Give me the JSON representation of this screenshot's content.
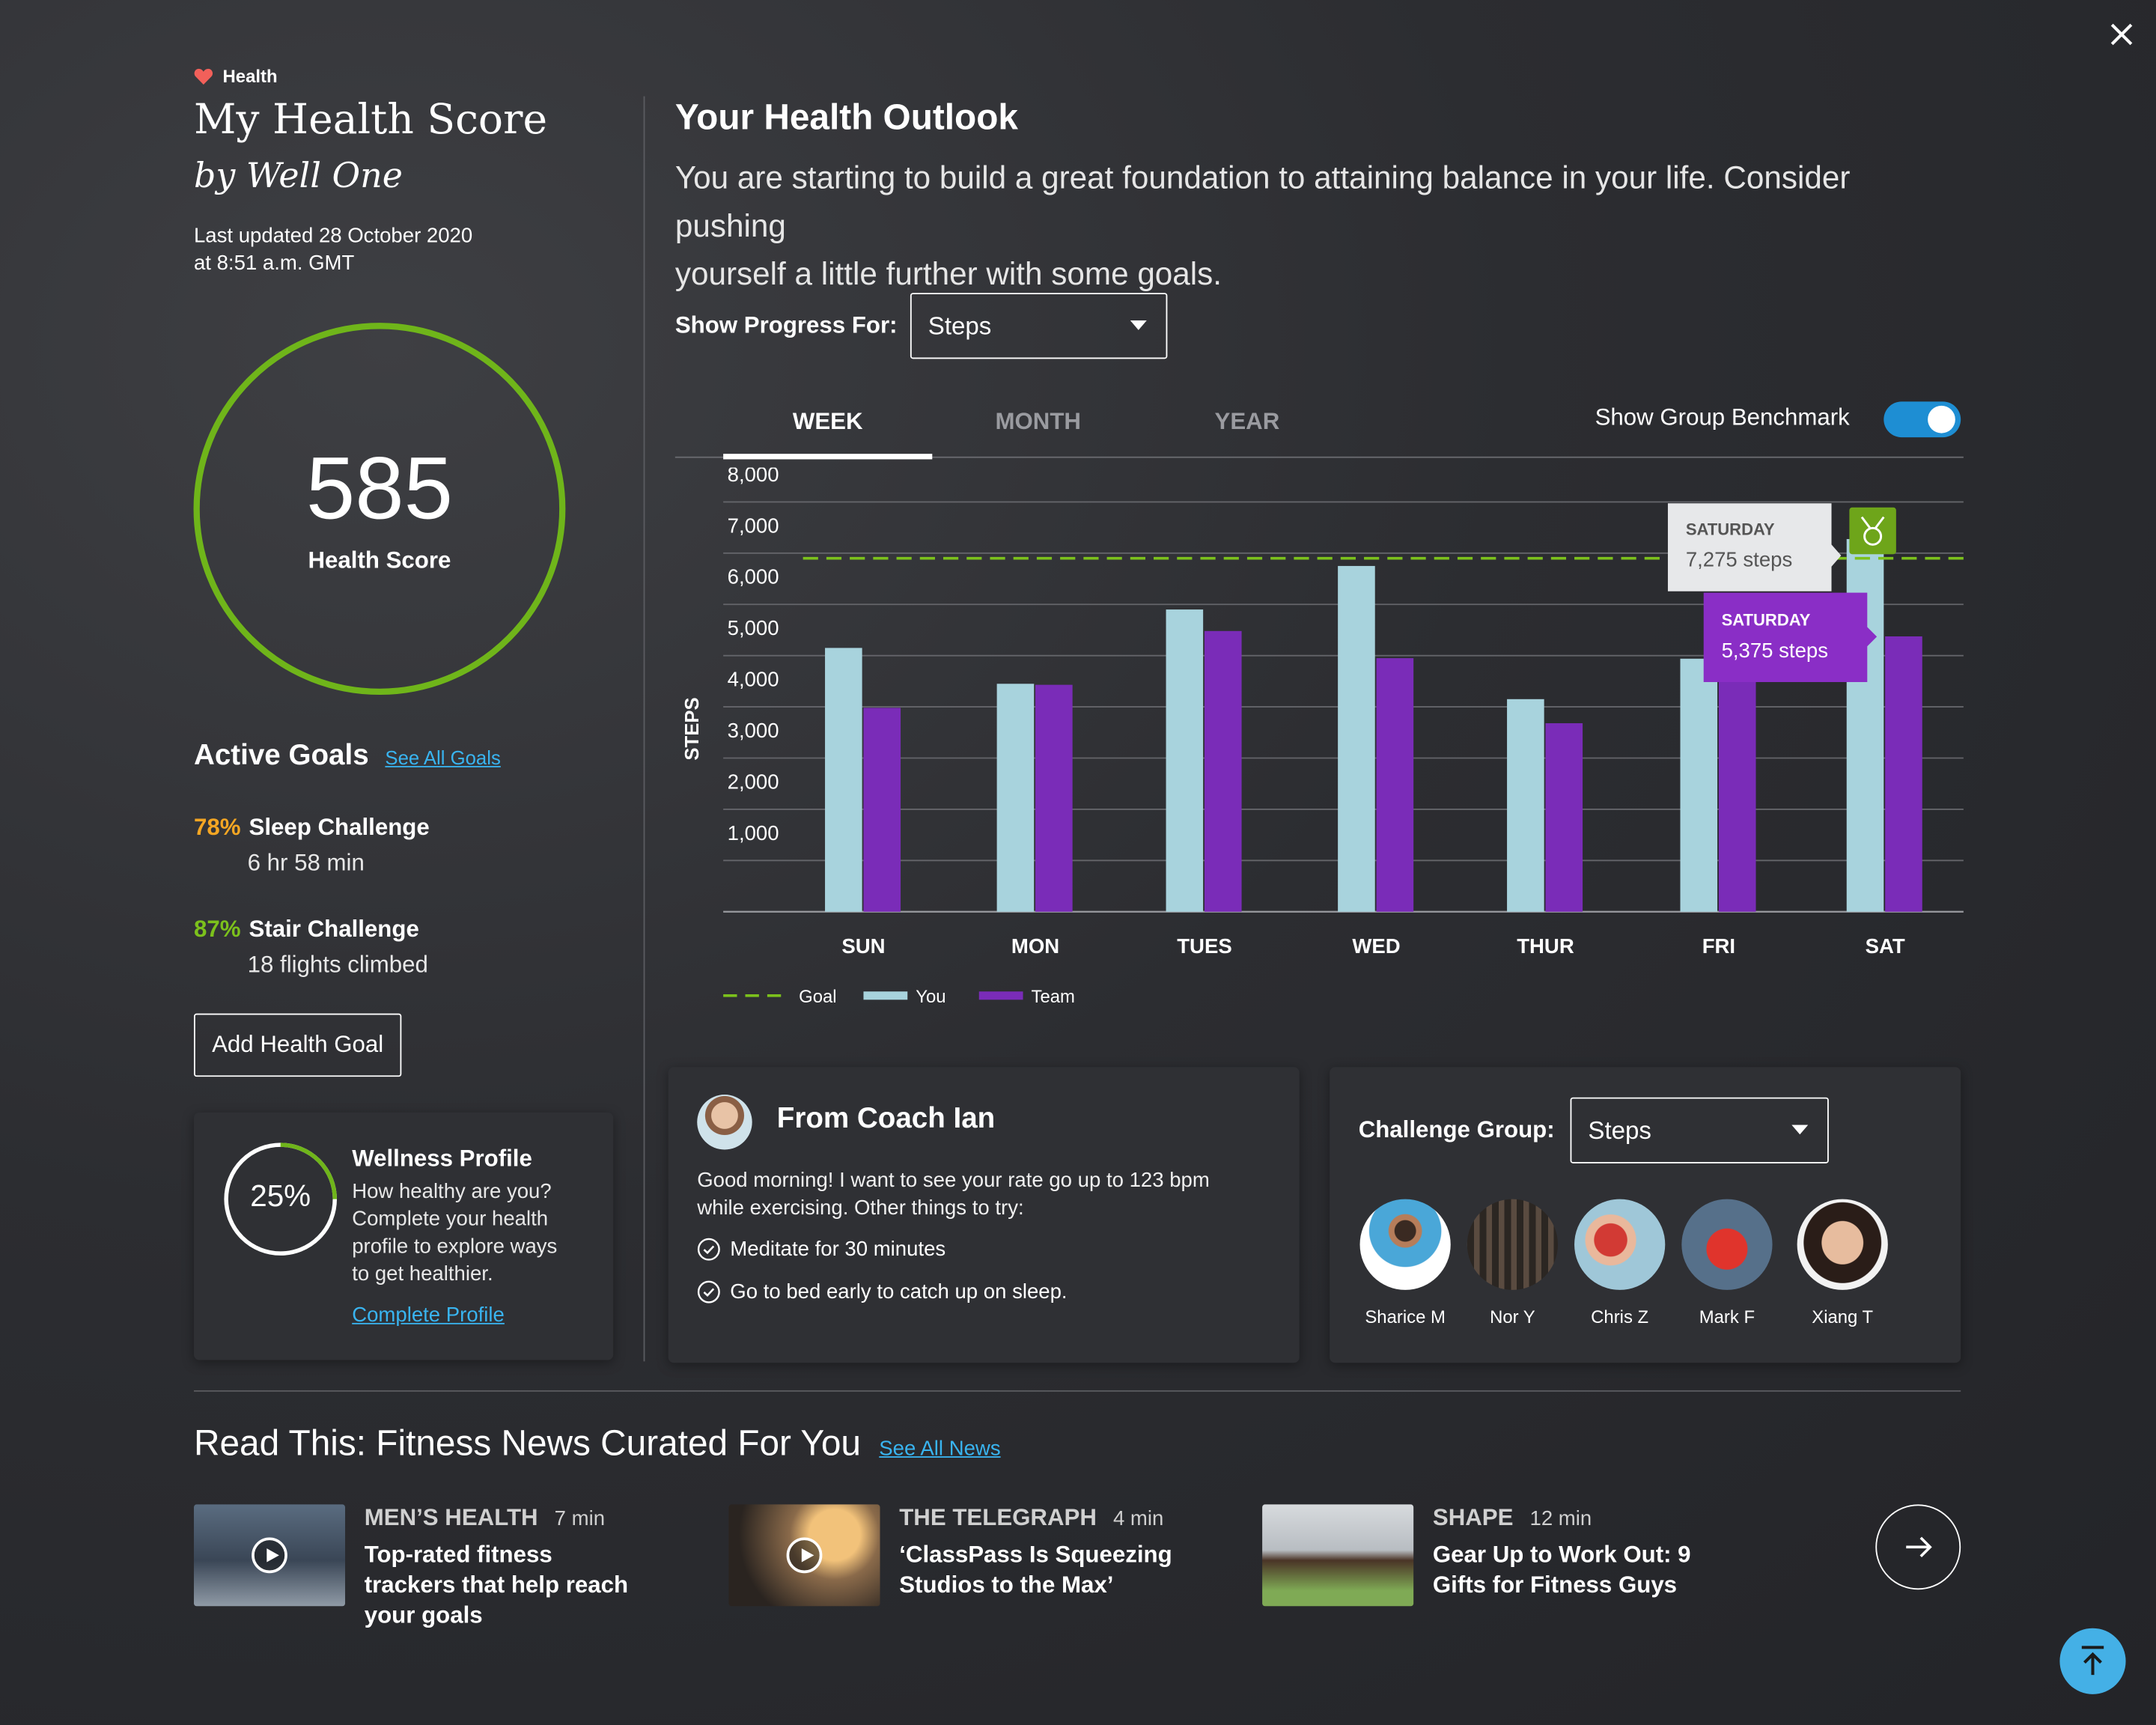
{
  "brand": {
    "label": "Health"
  },
  "header": {
    "title": "My Health Score",
    "subtitle": "by Well One",
    "updated_line1": "Last updated 28 October 2020",
    "updated_line2": "at 8:51 a.m. GMT"
  },
  "score": {
    "value": "585",
    "label": "Health Score"
  },
  "goals": {
    "heading": "Active Goals",
    "see_all": "See All Goals",
    "items": [
      {
        "pct": "78%",
        "name": "Sleep Challenge",
        "detail": "6 hr 58 min",
        "color": "#f5a623"
      },
      {
        "pct": "87%",
        "name": "Stair Challenge",
        "detail": "18 flights climbed",
        "color": "#7cc11c"
      }
    ],
    "add_button": "Add Health Goal"
  },
  "wellness": {
    "pct": "25%",
    "progress": 0.25,
    "title": "Wellness Profile",
    "line1": "How healthy are you?",
    "line2": "Complete your health",
    "line3": "profile to explore ways",
    "line4": "to get healthier.",
    "link": "Complete Profile"
  },
  "outlook": {
    "title": "Your Health Outlook",
    "line1": "You are starting to build a great foundation to attaining balance in your life.  Consider pushing",
    "line2": "yourself a little further with some goals."
  },
  "progress": {
    "label": "Show Progress For:",
    "selected": "Steps"
  },
  "tabs": [
    {
      "label": "WEEK",
      "active": true
    },
    {
      "label": "MONTH"
    },
    {
      "label": "YEAR"
    }
  ],
  "benchmark": {
    "label": "Show Group Benchmark",
    "enabled": true
  },
  "chart_data": {
    "type": "bar",
    "ylabel": "STEPS",
    "ylim": [
      0,
      8000
    ],
    "yticks": [
      "1,000",
      "2,000",
      "3,000",
      "4,000",
      "5,000",
      "6,000",
      "7,000",
      "8,000"
    ],
    "categories": [
      "SUN",
      "MON",
      "TUES",
      "WED",
      "THUR",
      "FRI",
      "SAT"
    ],
    "series": [
      {
        "name": "You",
        "color": "#a8d3dd",
        "values": [
          5150,
          4450,
          5900,
          6750,
          4150,
          4940,
          7275
        ]
      },
      {
        "name": "Team",
        "color": "#7a2cb8",
        "values": [
          3980,
          4430,
          5480,
          4950,
          3680,
          4790,
          5375
        ]
      }
    ],
    "goal": {
      "name": "Goal",
      "value": 6900,
      "color": "#7cc11c"
    },
    "tooltips": [
      {
        "day": "SATURDAY",
        "value": "7,275 steps"
      },
      {
        "day": "SATURDAY",
        "value": "5,375 steps"
      }
    ]
  },
  "coach": {
    "title": "From Coach Ian",
    "message1": "Good morning!  I want to see your rate go up to 123 bpm",
    "message2": "while exercising. Other things to try:",
    "tips": [
      "Meditate for 30 minutes",
      "Go to bed early to catch up on sleep."
    ]
  },
  "challenge": {
    "label": "Challenge Group:",
    "selected": "Steps",
    "members": [
      "Sharice  M",
      "Nor Y",
      "Chris Z",
      "Mark F",
      "Xiang T"
    ]
  },
  "news": {
    "heading": "Read This: Fitness News Curated For You",
    "see_all": "See All News",
    "items": [
      {
        "source": "MEN’S HEALTH",
        "time": "7 min",
        "title": "Top-rated fitness trackers that help reach your goals"
      },
      {
        "source": "THE TELEGRAPH",
        "time": "4 min",
        "title": "‘ClassPass Is Squeezing Studios to the Max’"
      },
      {
        "source": "SHAPE",
        "time": "12 min",
        "title": "Gear Up to Work Out: 9 Gifts for Fitness Guys"
      }
    ]
  }
}
